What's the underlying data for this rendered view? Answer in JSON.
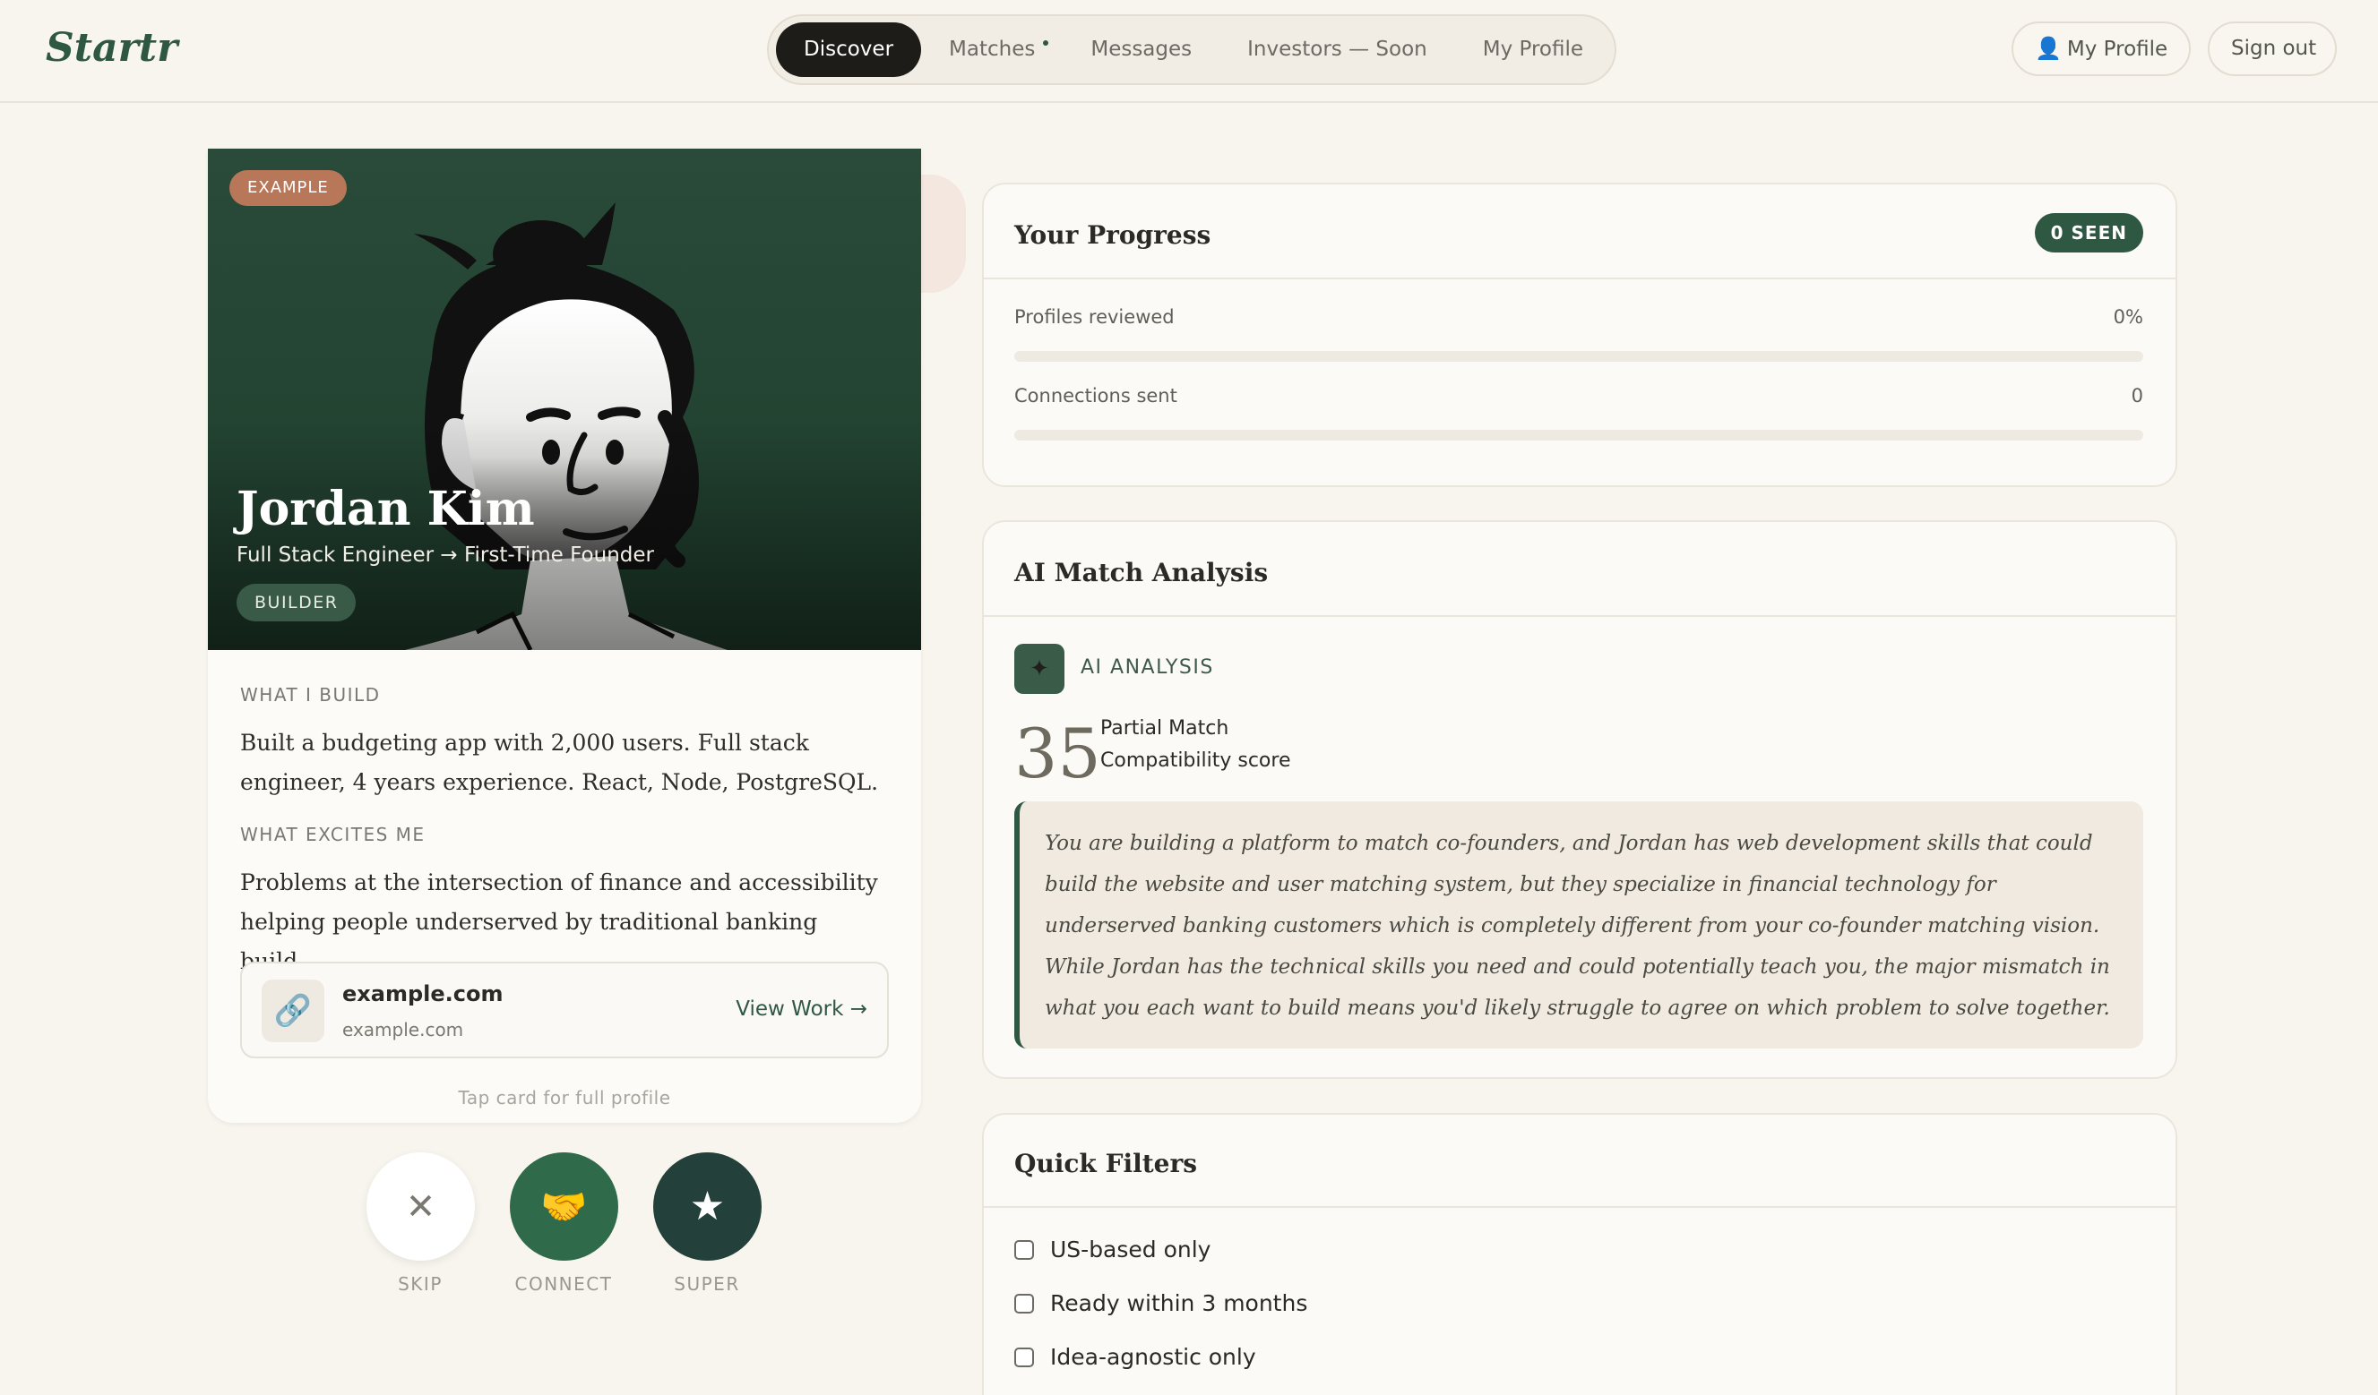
{
  "header": {
    "logo": "Startr",
    "nav": [
      {
        "label": "Discover",
        "active": true,
        "has_dot": false
      },
      {
        "label": "Matches",
        "active": false,
        "has_dot": true
      },
      {
        "label": "Messages",
        "active": false,
        "has_dot": false
      },
      {
        "label": "Investors — Soon",
        "active": false,
        "has_dot": false
      },
      {
        "label": "My Profile",
        "active": false,
        "has_dot": false
      }
    ],
    "profile_button": "My Profile",
    "signout_button": "Sign out"
  },
  "card": {
    "badge": "EXAMPLE",
    "name": "Jordan Kim",
    "role": "Full Stack Engineer → First-Time Founder",
    "type_badge": "BUILDER",
    "what_i_build_label": "WHAT I BUILD",
    "what_i_build_text": "Built a budgeting app with 2,000 users. Full stack engineer, 4 years experience. React, Node, PostgreSQL.",
    "what_excites_label": "WHAT EXCITES ME",
    "what_excites_text": "Problems at the intersection of finance and accessibility helping people underserved by traditional banking build...",
    "link": {
      "icon": "link-icon",
      "title": "example.com",
      "url": "example.com",
      "action": "View Work →"
    },
    "tap_hint": "Tap card for full profile"
  },
  "actions": [
    {
      "key": "skip",
      "label": "SKIP",
      "glyph": "✕"
    },
    {
      "key": "connect",
      "label": "CONNECT",
      "glyph": "🤝"
    },
    {
      "key": "super",
      "label": "SUPER",
      "glyph": "★"
    }
  ],
  "progress": {
    "title": "Your Progress",
    "badge": "0 SEEN",
    "rows": [
      {
        "label": "Profiles reviewed",
        "value": "0%",
        "fraction": 0
      },
      {
        "label": "Connections sent",
        "value": "0",
        "fraction": 0
      }
    ]
  },
  "ai": {
    "title": "AI Match Analysis",
    "label": "AI ANALYSIS",
    "score": "35",
    "score_title": "Partial Match",
    "score_sub": "Compatibility score",
    "analysis": "You are building a platform to match co-founders, and Jordan has web development skills that could build the website and user matching system, but they specialize in financial technology for underserved banking customers which is completely different from your co-founder matching vision. While Jordan has the technical skills you need and could potentially teach you, the major mismatch in what you each want to build means you'd likely struggle to agree on which problem to solve together."
  },
  "filters": {
    "title": "Quick Filters",
    "items": [
      {
        "label": "US-based only",
        "checked": false
      },
      {
        "label": "Ready within 3 months",
        "checked": false
      },
      {
        "label": "Idea-agnostic only",
        "checked": false
      }
    ]
  },
  "colors": {
    "brand": "#2f5843",
    "background": "#f8f5ef",
    "example_badge": "#b87758",
    "nav_active": "#1e1c19"
  }
}
